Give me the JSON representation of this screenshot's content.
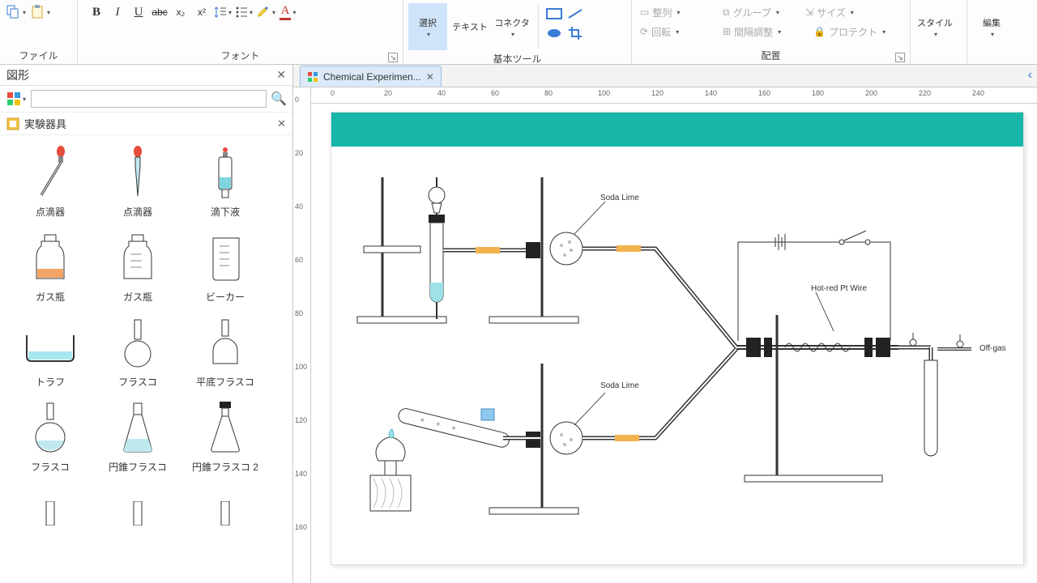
{
  "ribbon": {
    "file": {
      "label": "ファイル"
    },
    "font": {
      "label": "フォント",
      "bold": "B",
      "italic": "I",
      "underline": "U",
      "strike": "abc",
      "sub": "x₂",
      "sup": "x²"
    },
    "tools": {
      "label": "基本ツール",
      "select": "選択",
      "text": "テキスト",
      "connector": "コネクタ"
    },
    "arrange": {
      "label": "配置",
      "align": "整列",
      "rotate": "回転",
      "spacing": "間隔調整",
      "group": "グループ",
      "size": "サイズ",
      "protect": "プロテクト"
    },
    "style": {
      "label": "スタイル"
    },
    "edit": {
      "label": "編集"
    }
  },
  "side": {
    "title": "図形",
    "search_placeholder": "",
    "category": "実験器具",
    "shapes": [
      {
        "label": "点滴器"
      },
      {
        "label": "点滴器"
      },
      {
        "label": "滴下液"
      },
      {
        "label": "ガス瓶"
      },
      {
        "label": "ガス瓶"
      },
      {
        "label": "ビーカー"
      },
      {
        "label": "トラフ"
      },
      {
        "label": "フラスコ"
      },
      {
        "label": "平底フラスコ"
      },
      {
        "label": "フラスコ"
      },
      {
        "label": "円錐フラスコ"
      },
      {
        "label": "円錐フラスコ 2"
      }
    ]
  },
  "tab": {
    "title": "Chemical Experimen..."
  },
  "ruler_h": [
    "0",
    "20",
    "40",
    "60",
    "80",
    "100",
    "120",
    "140",
    "160",
    "180",
    "200",
    "220",
    "240"
  ],
  "ruler_v": [
    "0",
    "20",
    "40",
    "60",
    "80",
    "100",
    "120",
    "140",
    "160"
  ],
  "diagram": {
    "soda1": "Soda Lime",
    "soda2": "Soda Lime",
    "wire": "Hot-red Pt Wire",
    "offgas": "Off-gas"
  }
}
